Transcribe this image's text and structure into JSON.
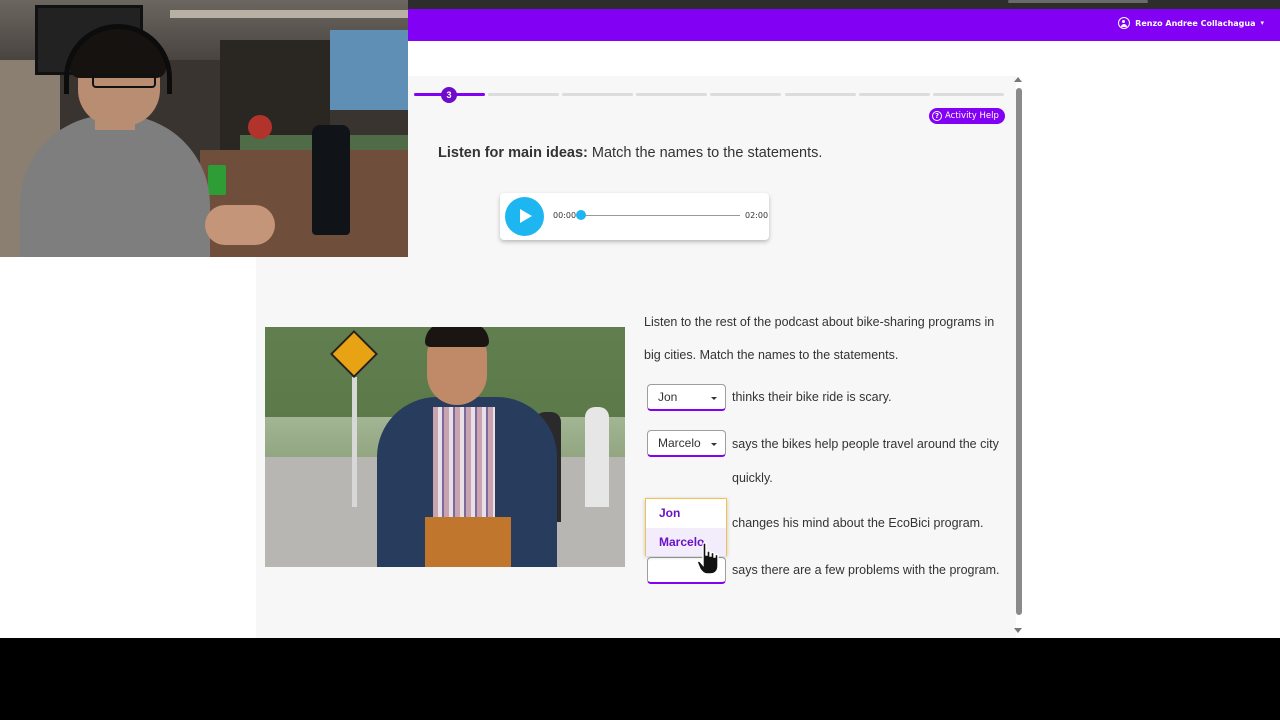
{
  "header": {
    "user_name": "Renzo Andree Collachagua",
    "user_icon": "user-circle-icon",
    "chevron_icon": "chevron-down-icon"
  },
  "progress": {
    "current_step": "3",
    "total_segments": 8,
    "completed_segments": 1
  },
  "activity_help": {
    "label": "Activity Help",
    "icon": "question-circle-icon"
  },
  "instruction": {
    "bold": "Listen for main ideas:",
    "text": " Match the names to the statements."
  },
  "audio_player": {
    "current_time": "00:00",
    "total_time": "02:00",
    "progress": 0,
    "play_icon": "play-icon"
  },
  "exercise": {
    "description": "Listen to the rest of the podcast about bike-sharing programs in big cities. Match the names to the statements.",
    "items": [
      {
        "selected": "Jon",
        "statement": "thinks their bike ride is scary."
      },
      {
        "selected": "Marcelo",
        "statement": "says the bikes help people travel around the city quickly."
      },
      {
        "selected": "",
        "statement": "changes his mind about the EcoBici program."
      },
      {
        "selected": "",
        "statement": "says there are a few problems with the program."
      }
    ],
    "dropdown_options": [
      "Jon",
      "Marcelo"
    ]
  },
  "colors": {
    "brand_purple": "#8200f4",
    "play_blue": "#1eb6f0",
    "dropdown_highlight": "#f2c14e"
  }
}
